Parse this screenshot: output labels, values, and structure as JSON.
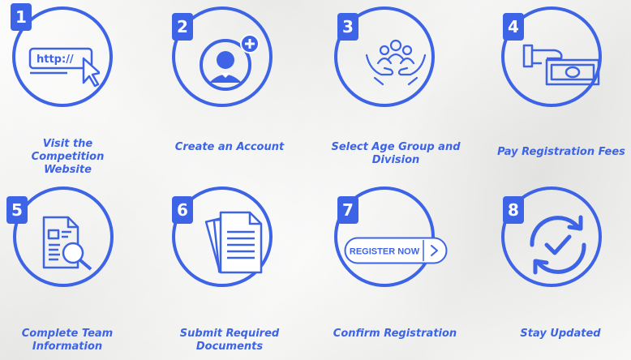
{
  "colors": {
    "accent": "#3d63e6",
    "background": "#eeeeec"
  },
  "steps": [
    {
      "number": "1",
      "label_lines": [
        "Visit the Competition",
        "Website"
      ],
      "icon": "browser-cursor-icon",
      "icon_text": "http://"
    },
    {
      "number": "2",
      "label_lines": [
        "Create an Account"
      ],
      "icon": "user-add-icon"
    },
    {
      "number": "3",
      "label_lines": [
        "Select Age Group and",
        "Division"
      ],
      "icon": "group-hands-icon"
    },
    {
      "number": "4",
      "label_lines": [
        "Pay Registration Fees"
      ],
      "icon": "hand-money-icon"
    },
    {
      "number": "5",
      "label_lines": [
        "Complete Team",
        "Information"
      ],
      "icon": "document-search-icon"
    },
    {
      "number": "6",
      "label_lines": [
        "Submit Required",
        "Documents"
      ],
      "icon": "documents-stack-icon"
    },
    {
      "number": "7",
      "label_lines": [
        "Confirm Registration"
      ],
      "icon": "register-button-icon",
      "icon_text": "REGISTER NOW"
    },
    {
      "number": "8",
      "label_lines": [
        "Stay Updated"
      ],
      "icon": "sync-check-icon"
    }
  ]
}
